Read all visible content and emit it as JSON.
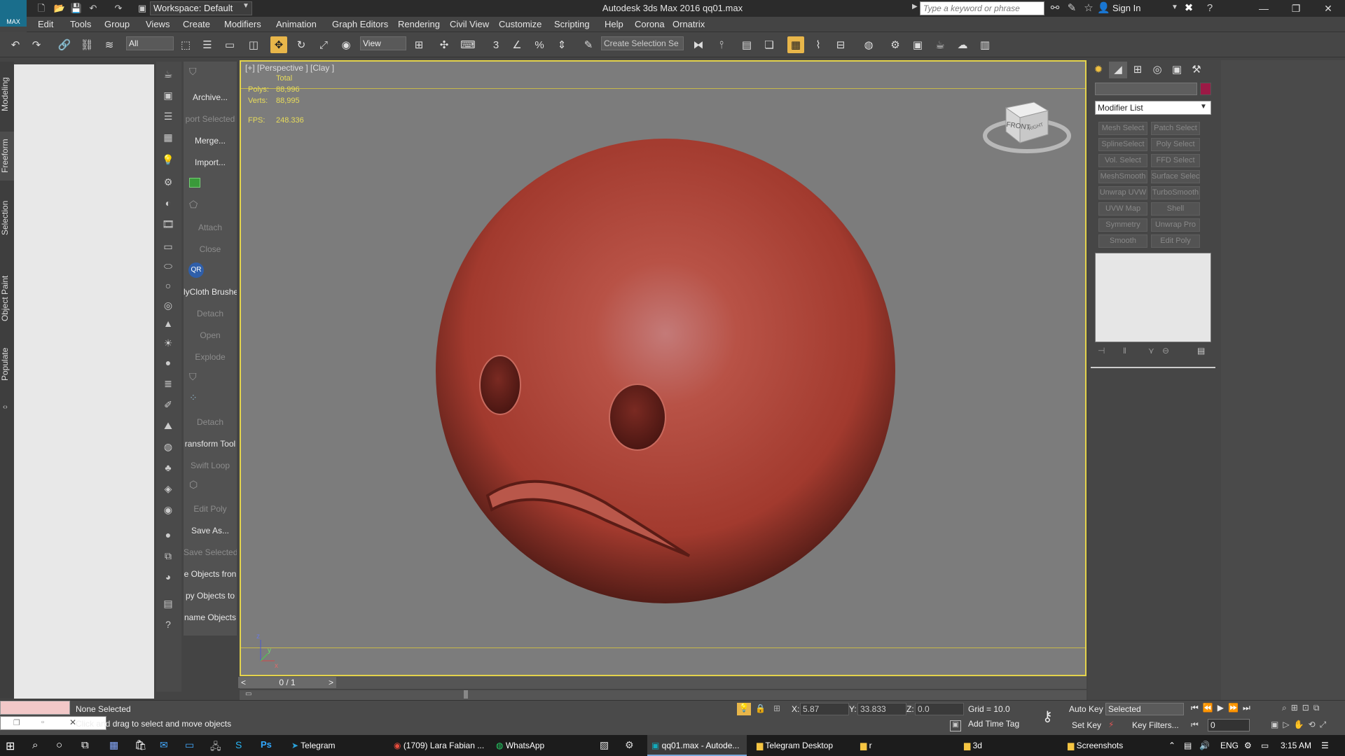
{
  "app": {
    "logo_text": "MAX",
    "title": "Autodesk 3ds Max 2016     qq01.max",
    "workspace": "Workspace: Default",
    "search_placeholder": "Type a keyword or phrase",
    "sign_in": "Sign In"
  },
  "menu": [
    "Edit",
    "Tools",
    "Group",
    "Views",
    "Create",
    "Modifiers",
    "Animation",
    "Graph Editors",
    "Rendering",
    "Civil View",
    "Customize",
    "Scripting",
    "Help",
    "Corona",
    "Ornatrix"
  ],
  "toolbar": {
    "filter_value": "All",
    "ref_coord": "View",
    "selection_set_placeholder": "Create Selection Se"
  },
  "ribbon_tabs": [
    "Modeling",
    "Freeform",
    "Selection",
    "Object Paint",
    "Populate"
  ],
  "command_labels": [
    {
      "text": "Archive...",
      "enabled": true
    },
    {
      "text": "port Selected",
      "enabled": false
    },
    {
      "text": "Merge...",
      "enabled": true
    },
    {
      "text": "Import...",
      "enabled": true
    },
    {
      "text": "Attach",
      "enabled": false
    },
    {
      "text": "Close",
      "enabled": false
    },
    {
      "text": "lyCloth Brushe",
      "enabled": true
    },
    {
      "text": "Detach",
      "enabled": false
    },
    {
      "text": "Open",
      "enabled": false
    },
    {
      "text": "Explode",
      "enabled": false
    },
    {
      "text": "Detach",
      "enabled": false
    },
    {
      "text": "ransform Tool",
      "enabled": true
    },
    {
      "text": "Swift Loop",
      "enabled": false
    },
    {
      "text": "Edit Poly",
      "enabled": false
    },
    {
      "text": "Save As...",
      "enabled": true
    },
    {
      "text": "Save Selected",
      "enabled": false
    },
    {
      "text": "e Objects fron",
      "enabled": true
    },
    {
      "text": "py Objects to",
      "enabled": true
    },
    {
      "text": "name Objects",
      "enabled": true
    }
  ],
  "viewport": {
    "label": "[+] [Perspective ] [Clay ]",
    "stats_header": "Total",
    "polys_label": "Polys:",
    "polys_value": "88,996",
    "verts_label": "Verts:",
    "verts_value": "88,995",
    "fps_label": "FPS:",
    "fps_value": "248.336",
    "viewcube_front": "FRONT",
    "viewcube_right": "RIGHT",
    "axis_z": "z",
    "axis_y": "y",
    "axis_x": "x",
    "object_color": "#b84a3f"
  },
  "timeline": {
    "frame": "0 / 1",
    "prev": "<",
    "next": ">"
  },
  "command_panel": {
    "modifier_list": "Modifier List",
    "swatch_color": "#9c1a46",
    "modifier_buttons": [
      "Mesh Select",
      "Patch Select",
      "SplineSelect",
      "Poly Select",
      "Vol. Select",
      "FFD Select",
      "MeshSmooth",
      "Surface Select",
      "Unwrap UVW",
      "TurboSmooth",
      "UVW Map",
      "Shell",
      "Symmetry",
      "Unwrap Pro",
      "Smooth",
      "Edit Poly"
    ]
  },
  "status": {
    "selection": "None Selected",
    "prompt": "Click and drag to select and move objects",
    "x_label": "X:",
    "x_value": "5.87",
    "y_label": "Y:",
    "y_value": "33.833",
    "z_label": "Z:",
    "z_value": "0.0",
    "grid": "Grid = 10.0",
    "add_time_tag": "Add Time Tag",
    "auto_key": "Auto Key",
    "set_key": "Set Key",
    "key_mode": "Selected",
    "key_filters": "Key Filters...",
    "current_frame": "0"
  },
  "taskbar": {
    "apps": [
      {
        "label": "Telegram",
        "active": false
      },
      {
        "label": "(1709) Lara Fabian ...",
        "active": false
      },
      {
        "label": "WhatsApp",
        "active": false
      },
      {
        "label": "qq01.max - Autode...",
        "active": true
      },
      {
        "label": "Telegram Desktop",
        "active": false
      },
      {
        "label": "r",
        "active": false
      },
      {
        "label": "3d",
        "active": false
      },
      {
        "label": "Screenshots",
        "active": false
      }
    ],
    "language": "ENG",
    "time": "3:15 AM"
  }
}
